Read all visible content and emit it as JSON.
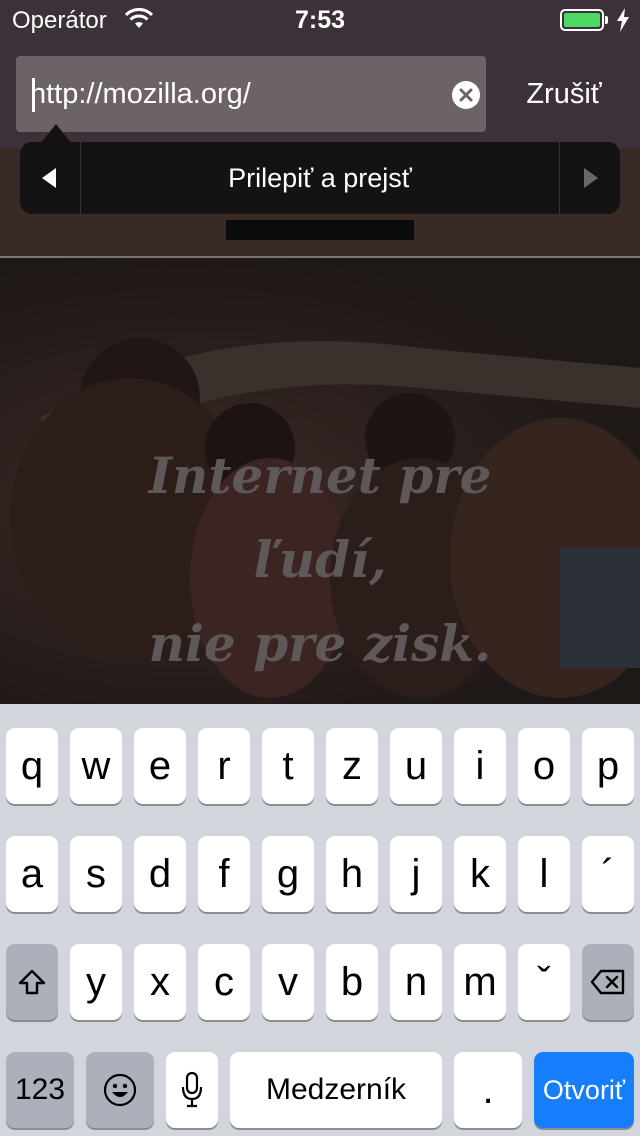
{
  "status_bar": {
    "carrier": "Operátor",
    "time": "7:53"
  },
  "url_bar": {
    "value": "http://mozilla.org/",
    "cancel_label": "Zrušiť"
  },
  "context_menu": {
    "label": "Prilepiť a prejsť"
  },
  "hero": {
    "line1": "Internet pre",
    "line2": "ľudí,",
    "line3": "nie pre zisk."
  },
  "keyboard": {
    "row1": [
      "q",
      "w",
      "e",
      "r",
      "t",
      "z",
      "u",
      "i",
      "o",
      "p"
    ],
    "row2": [
      "a",
      "s",
      "d",
      "f",
      "g",
      "h",
      "j",
      "k",
      "l",
      "´"
    ],
    "row3": [
      "y",
      "x",
      "c",
      "v",
      "b",
      "n",
      "m",
      "ˇ"
    ],
    "numbers_label": "123",
    "space_label": "Medzerník",
    "period_label": ".",
    "go_label": "Otvoriť"
  },
  "colors": {
    "accent": "#167efb",
    "battery": "#4cd964"
  },
  "icons": [
    "wifi-icon",
    "battery-icon",
    "charging-bolt-icon",
    "clear-text-icon",
    "arrow-left-icon",
    "arrow-right-icon",
    "shift-icon",
    "backspace-icon",
    "emoji-icon",
    "microphone-icon"
  ]
}
